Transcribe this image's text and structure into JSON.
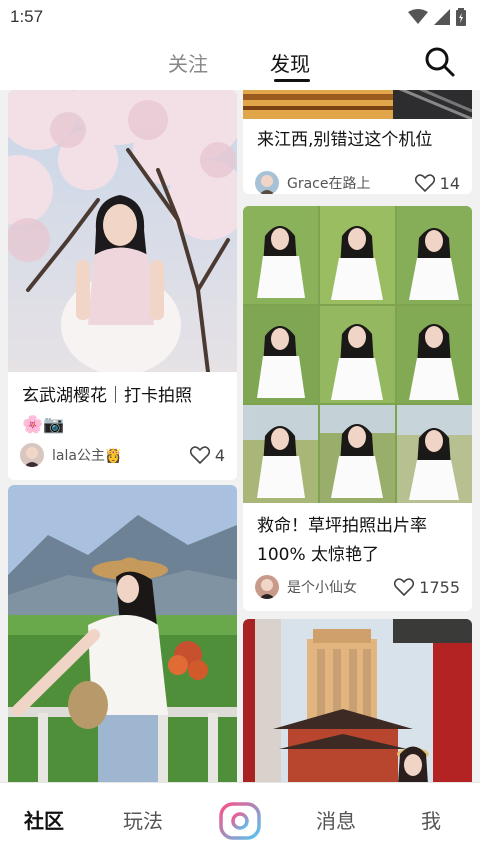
{
  "status_bar": {
    "time": "1:57"
  },
  "header": {
    "tabs": [
      {
        "label": "关注",
        "active": false
      },
      {
        "label": "发现",
        "active": true
      }
    ]
  },
  "feed": {
    "cards": [
      {
        "title_line1": "玄武湖樱花｜打卡拍照",
        "title_line2": "🌸📷",
        "author": "lala公主👸",
        "likes": "4"
      },
      {
        "title_line1": "来江西,别错过这个机位",
        "author": "Grace在路上",
        "likes": "14"
      },
      {
        "title_line1": "救命！草坪拍照出片率",
        "title_line2": "100% 太惊艳了",
        "author": "是个小仙女",
        "likes": "1755"
      }
    ]
  },
  "bottom_nav": {
    "items": [
      {
        "label": "社区",
        "active": true
      },
      {
        "label": "玩法",
        "active": false
      },
      {
        "label": "消息",
        "active": false
      },
      {
        "label": "我",
        "active": false
      }
    ]
  },
  "colors": {
    "accent_gradient_start": "#ff5a8a",
    "accent_gradient_end": "#4fc3f7"
  }
}
